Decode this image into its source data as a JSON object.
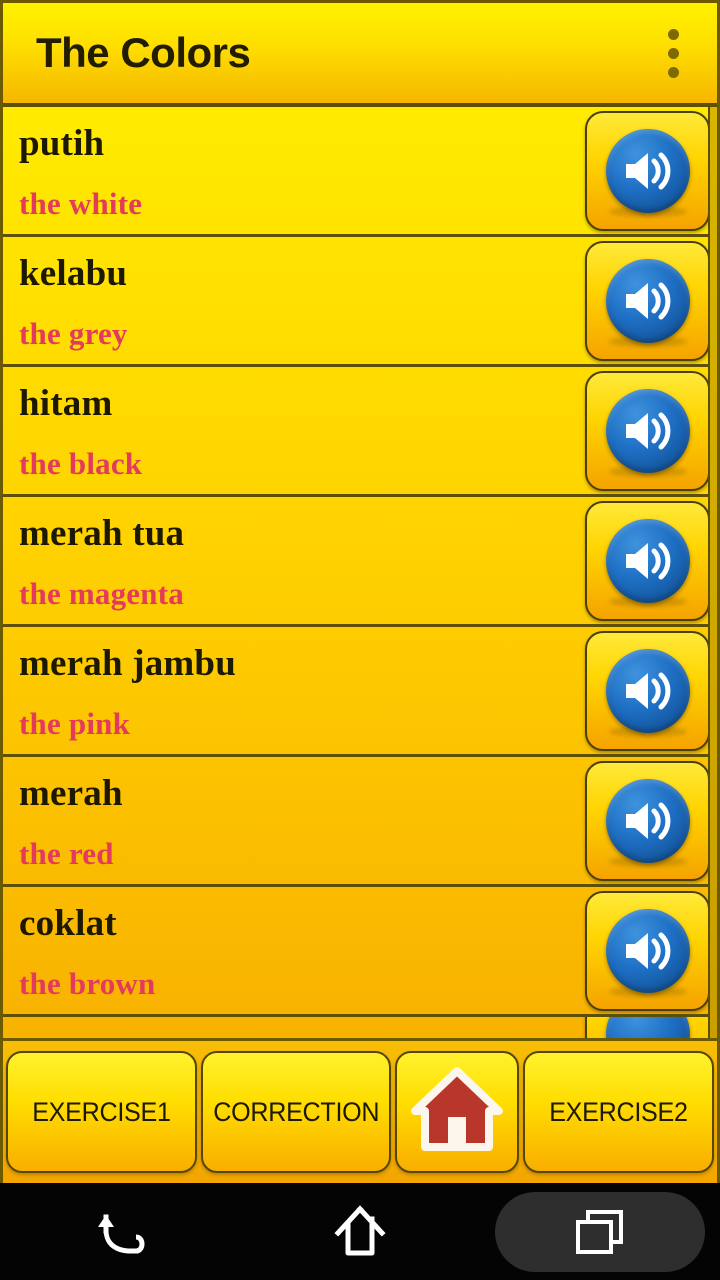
{
  "header": {
    "title": "The Colors",
    "overflow_icon": "more-vert-icon"
  },
  "list": {
    "speaker_icon": "speaker-volume-icon",
    "items": [
      {
        "word": "putih",
        "translation": "the white"
      },
      {
        "word": "kelabu",
        "translation": "the grey"
      },
      {
        "word": "hitam",
        "translation": "the black"
      },
      {
        "word": "merah tua",
        "translation": "the magenta"
      },
      {
        "word": "merah jambu",
        "translation": "the pink"
      },
      {
        "word": "merah",
        "translation": "the red"
      },
      {
        "word": "coklat",
        "translation": "the brown"
      }
    ]
  },
  "bottom_bar": {
    "exercise1": "EXERCISE1",
    "correction": "CORRECTION",
    "home_icon": "home-house-icon",
    "exercise2": "EXERCISE2"
  },
  "navbar": {
    "back_icon": "back-arrow-icon",
    "home_icon": "home-outline-icon",
    "recents_icon": "recent-apps-icon"
  },
  "colors": {
    "page_top": "#FFF100",
    "page_bottom": "#F6A800",
    "word_text": "#1d1900",
    "translation_text": "#e43a5c",
    "speaker_blue": "#1e6fc4",
    "house_red": "#b8362a",
    "divider": "#5e4f06"
  }
}
